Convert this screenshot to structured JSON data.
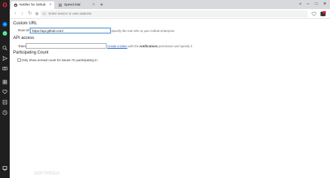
{
  "tabs": [
    {
      "label": "Notifier for Github",
      "active": true
    },
    {
      "label": "Speed Dial",
      "active": false
    }
  ],
  "new_tab_symbol": "+",
  "close_symbol": "×",
  "window_controls": {
    "search": "⌕",
    "minimize": "─",
    "maximize": "□",
    "close": "✕"
  },
  "toolbar": {
    "back": "‹",
    "forward": "›",
    "reload": "↻",
    "address_placeholder": "Enter search or web address"
  },
  "custom_url": {
    "heading": "Custom URL",
    "root_label": "Root URL:",
    "root_value": "https://api.github.com/",
    "hint": "Specify the root URL to your Github Enterprise"
  },
  "api_access": {
    "heading": "API access",
    "token_label": "Token:",
    "token_value": "",
    "hint_link": "Create a token",
    "hint_mid": "with the",
    "hint_bold": "notifications",
    "hint_end": "permission and specify it"
  },
  "participating": {
    "heading": "Participating Count",
    "checkbox_label": "Only show unread count for issues I'm participating in",
    "checked": false
  },
  "watermark": "SOFTPEDIA",
  "colors": {
    "sidebar": "#1f1f1f",
    "opera_red": "#e4202e",
    "whatsapp_green": "#25d366",
    "messenger_blue": "#0084ff",
    "link": "#1a56c9"
  }
}
